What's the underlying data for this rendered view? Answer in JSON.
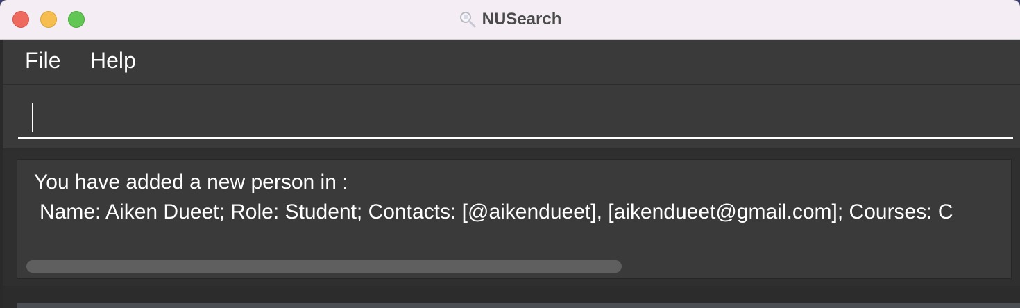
{
  "window": {
    "title": "NUSearch",
    "app_icon": "magnifier-icon"
  },
  "menu": {
    "items": [
      {
        "label": "File"
      },
      {
        "label": "Help"
      }
    ]
  },
  "command_box": {
    "value": "",
    "placeholder": ""
  },
  "result_display": {
    "line1": "You have added a new person in :",
    "line2": " Name: Aiken Dueet; Role: Student; Contacts: [@aikendueet], [aikendueet@gmail.com]; Courses: C"
  },
  "colors": {
    "background": "#3a3a3a",
    "text": "#ffffff",
    "titlebar": "#f4eef4"
  }
}
